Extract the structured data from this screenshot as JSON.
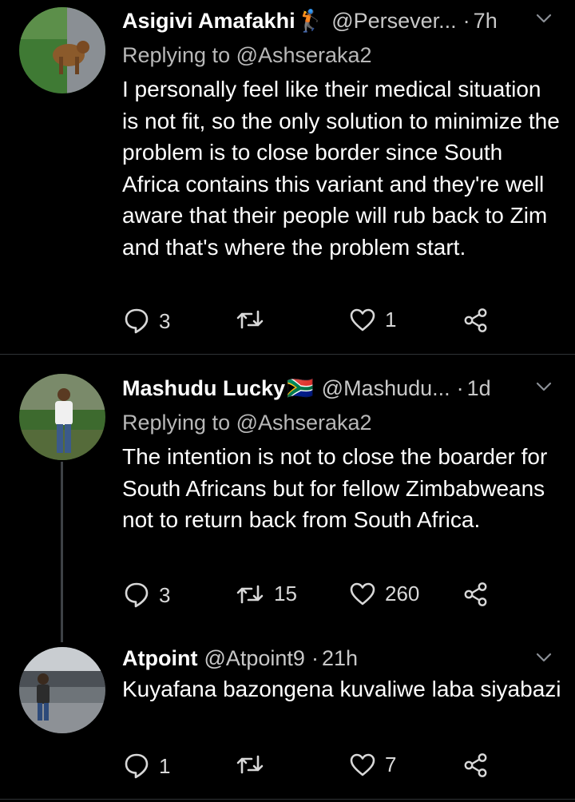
{
  "tweets": [
    {
      "name": "Asigivi Amafakhi",
      "name_emoji": "🏌",
      "handle": "@Persever...",
      "dot": "·",
      "time": "7h",
      "replying_to": "Replying to @Ashseraka2",
      "text": "I personally feel like their medical situation is not fit, so the only solution to minimize the problem is to close border since South Africa contains this variant and they're well aware that their people will rub back to Zim and that's where the problem start.",
      "reply_count": "3",
      "retweet_count": "",
      "like_count": "1"
    },
    {
      "name": "Mashudu Lucky",
      "name_emoji": "🇿🇦",
      "handle": "@Mashudu...",
      "dot": "·",
      "time": "1d",
      "replying_to": "Replying to @Ashseraka2",
      "text": "The intention is not to close the boarder for South Africans but for fellow Zimbabweans not to return back from South Africa.",
      "reply_count": "3",
      "retweet_count": "15",
      "like_count": "260"
    },
    {
      "name": "Atpoint",
      "name_emoji": "",
      "handle": "@Atpoint9",
      "dot": "·",
      "time": "21h",
      "replying_to": "",
      "text": "Kuyafana bazongena kuvaliwe laba siyabazi",
      "reply_count": "1",
      "retweet_count": "",
      "like_count": "7"
    }
  ],
  "icons": {
    "reply": "reply-icon",
    "retweet": "retweet-icon",
    "like": "heart-icon",
    "share": "share-icon",
    "more": "chevron-down-icon"
  },
  "colors": {
    "background": "#000000",
    "divider": "#2f3336",
    "secondary_text": "#c8c8c8"
  }
}
